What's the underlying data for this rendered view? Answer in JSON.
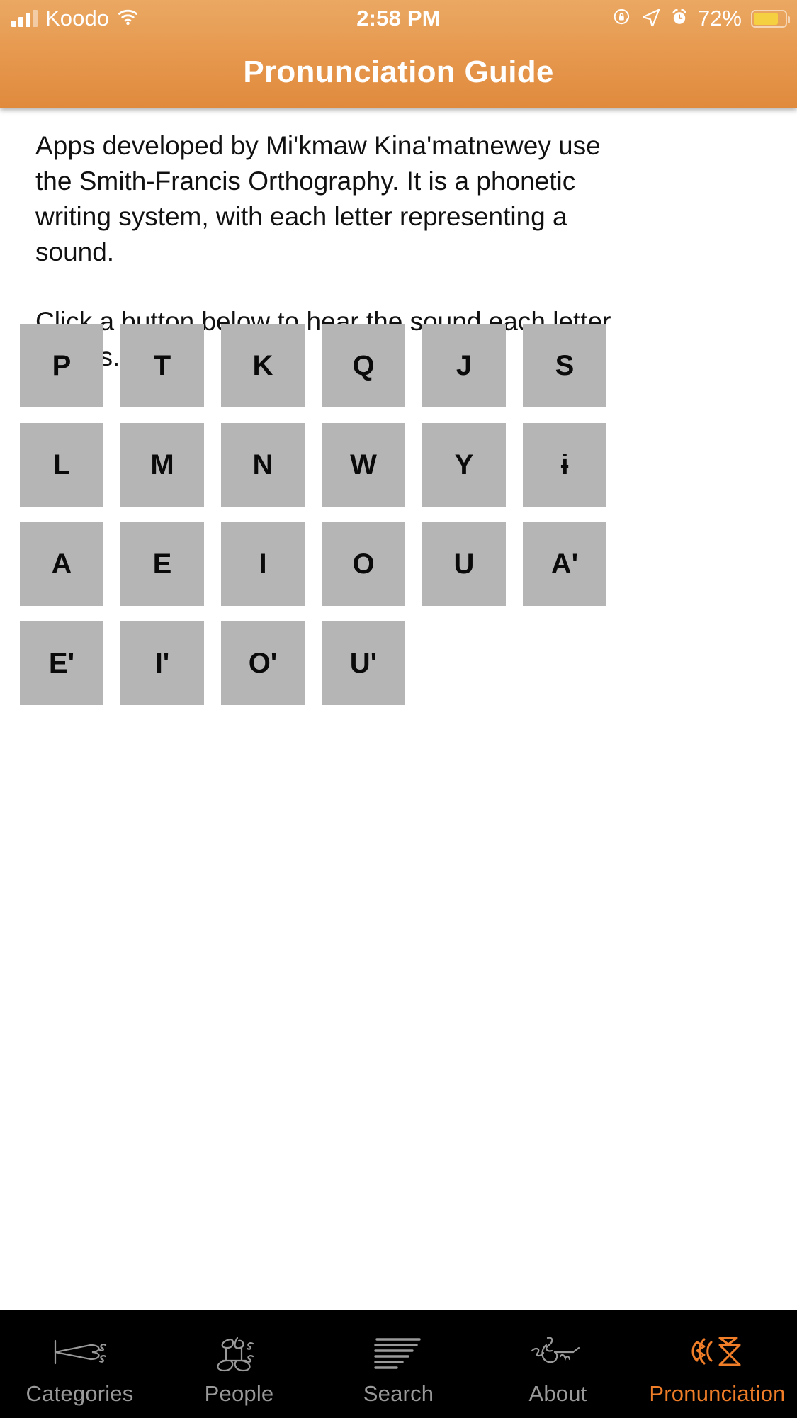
{
  "status_bar": {
    "carrier": "Koodo",
    "time": "2:58 PM",
    "battery_percent": "72%",
    "icons": [
      "signal-bars-icon",
      "wifi-icon",
      "rotation-lock-icon",
      "location-arrow-icon",
      "alarm-clock-icon",
      "battery-icon"
    ]
  },
  "header": {
    "title": "Pronunciation Guide",
    "background_start": "#eaa863",
    "background_end": "#e08a3d"
  },
  "content": {
    "paragraph_1": "Apps developed by Mi'kmaw Kina'matnewey use the Smith-Francis Orthography. It is a phonetic writing system, with each letter representing a sound.",
    "paragraph_2": "Click a button below to hear the sound each letter makes."
  },
  "letter_grid": {
    "button_color": "#b5b5b5",
    "text_color": "#0a0a0a",
    "columns": 6,
    "rows": [
      [
        "P",
        "T",
        "K",
        "Q",
        "J",
        "S"
      ],
      [
        "L",
        "M",
        "N",
        "W",
        "Y",
        "ɨ"
      ],
      [
        "A",
        "E",
        "I",
        "O",
        "U",
        "A'"
      ],
      [
        "E'",
        "I'",
        "O'",
        "U'",
        "",
        ""
      ]
    ]
  },
  "tab_bar": {
    "background": "#000000",
    "inactive_color": "#9a9a9a",
    "active_color": "#f07d28",
    "active_index": 4,
    "tabs": [
      {
        "label": "Categories",
        "icon": "mikmaw-hieroglyph-categories-icon"
      },
      {
        "label": "People",
        "icon": "mikmaw-hieroglyph-people-icon"
      },
      {
        "label": "Search",
        "icon": "mikmaw-hieroglyph-search-icon"
      },
      {
        "label": "About",
        "icon": "mikmaw-hieroglyph-about-icon"
      },
      {
        "label": "Pronunciation",
        "icon": "mikmaw-hieroglyph-pronunciation-icon"
      }
    ]
  }
}
